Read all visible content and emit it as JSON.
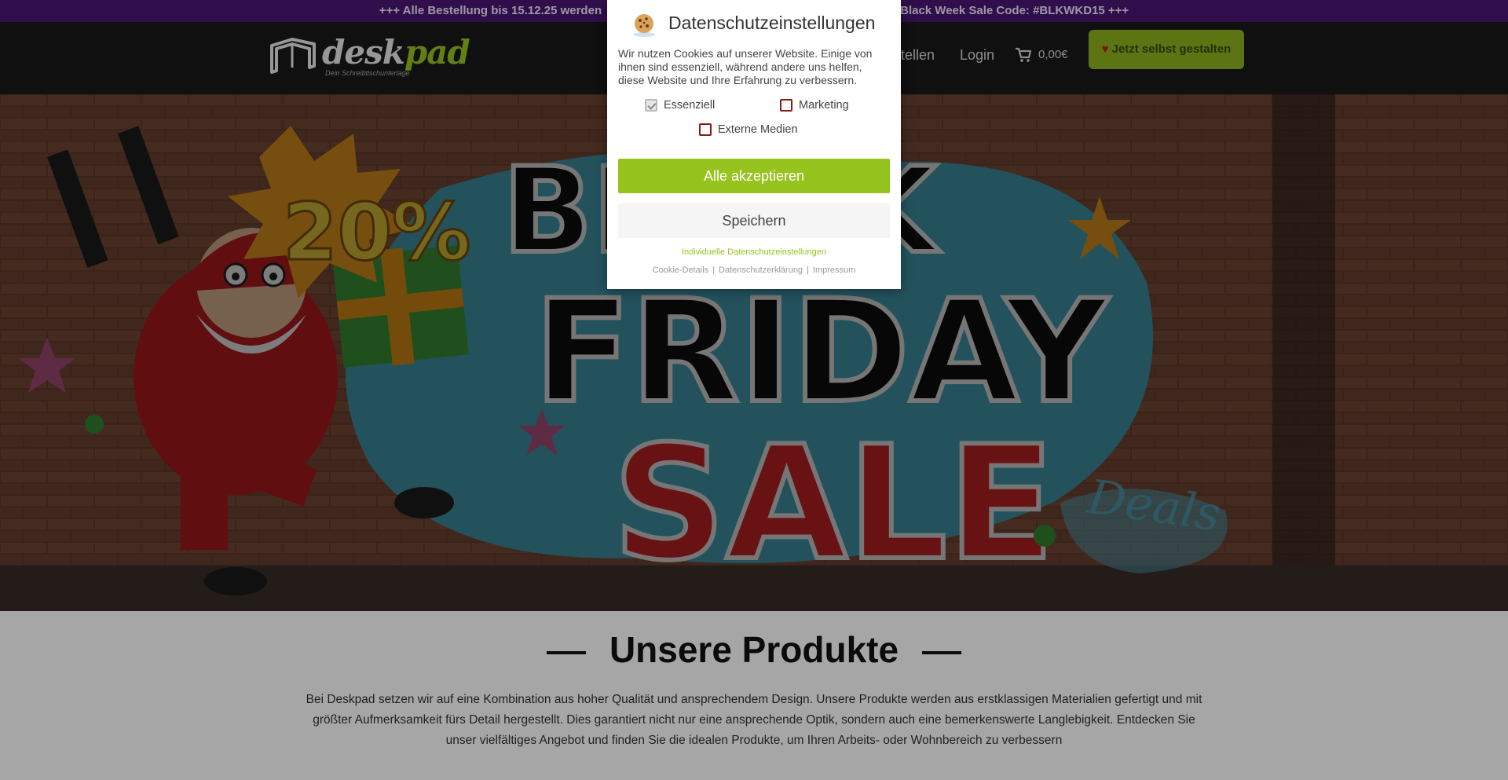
{
  "announcement": {
    "left": "+++ Alle Bestellung bis 15.12.25 werden",
    "right": "Black Week Sale Code: #BLKWKD15 +++"
  },
  "header": {
    "logo_word_main": "desk",
    "logo_word_accent": "pad",
    "logo_tagline": "Dein Schreibtischunterlage",
    "nav_bestellen": "stellen",
    "nav_login": "Login",
    "cart_total": "0,00€",
    "cta_label": "Jetzt selbst gestalten"
  },
  "hero": {
    "percent_text": "20%",
    "line1": "BLACK",
    "line2": "FRIDAY",
    "line3": "SALE",
    "tag": "Deals"
  },
  "products": {
    "title": "Unsere Produkte",
    "text": "Bei Deskpad setzen wir auf eine Kombination aus hoher Qualität und ansprechendem Design. Unsere Produkte werden aus erstklassigen Materialien gefertigt und mit größter Aufmerksamkeit fürs Detail hergestellt. Dies garantiert nicht nur eine ansprechende Optik, sondern auch eine bemerkenswerte Langlebigkeit. Entdecken Sie unser vielfältiges Angebot und finden Sie die idealen Produkte, um Ihren Arbeits- oder Wohnbereich zu verbessern"
  },
  "cookie_modal": {
    "title": "Datenschutzeinstellungen",
    "description": "Wir nutzen Cookies auf unserer Website. Einige von ihnen sind essenziell, während andere uns helfen, diese Website und Ihre Erfahrung zu verbessern.",
    "checkbox_essential": "Essenziell",
    "checkbox_marketing": "Marketing",
    "checkbox_external": "Externe Medien",
    "accept_all": "Alle akzeptieren",
    "save": "Speichern",
    "individual": "Individuelle Datenschutzeinstellungen",
    "link_cookie_details": "Cookie-Details",
    "link_privacy": "Datenschutzerklärung",
    "link_imprint": "Impressum",
    "separator": "|"
  },
  "colors": {
    "accent": "#97c31f",
    "announcement_bg": "#4a1673",
    "header_bg": "#1a1a1a"
  }
}
